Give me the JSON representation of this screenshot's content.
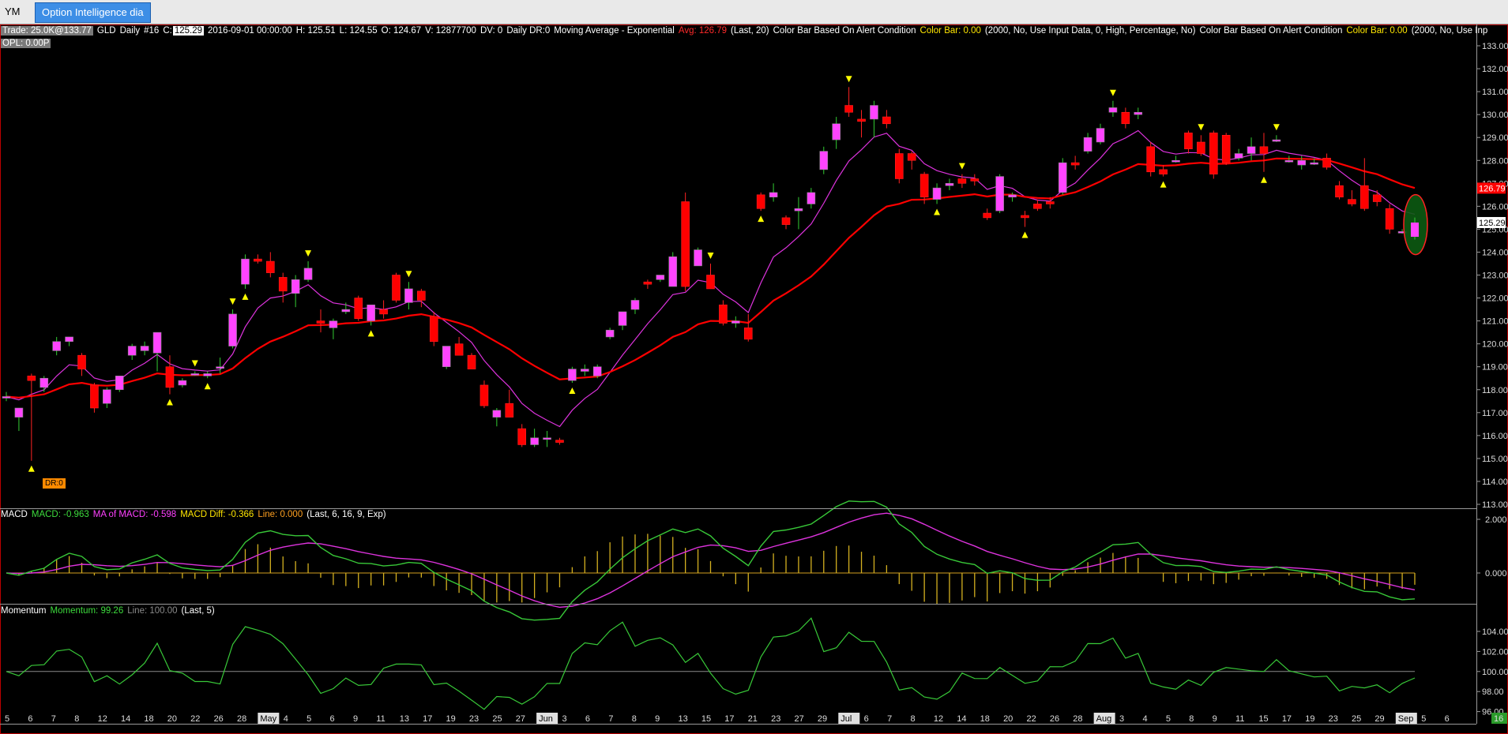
{
  "tabs": {
    "first": "YM",
    "active": "Option Intelligence dia"
  },
  "header": {
    "trade": "Trade: 25.0K@133.77",
    "symbol": "GLD",
    "interval": "Daily",
    "num": "#16",
    "c_label": "C:",
    "c_value": "125.29",
    "date": "2016-09-01 00:00:00",
    "h": "H: 125.51",
    "l": "L: 124.55",
    "o": "O: 124.67",
    "v": "V: 12877700",
    "dv": "DV: 0",
    "daily_dr": "Daily DR:0",
    "ma_name": "Moving Average - Exponential",
    "ma_avg": "Avg: 126.79",
    "ma_params": "(Last, 20)",
    "cb1_name": "Color Bar Based On Alert Condition",
    "cb1_value": "Color Bar: 0.00",
    "cb1_params": "(2000, No, Use Input Data, 0, High, Percentage, No)",
    "cb2_name": "Color Bar Based On Alert Condition",
    "cb2_value": "Color Bar: 0.00",
    "cb2_params": "(2000, No, Use Inp",
    "opl": "OPL: 0.00P"
  },
  "dr_badge": "DR:0",
  "macd": {
    "name": "MACD",
    "macd": "MACD: -0.963",
    "ma": "MA of MACD: -0.598",
    "diff": "MACD Diff: -0.366",
    "line": "Line: 0.000",
    "params": "(Last, 6, 16, 9, Exp)",
    "ticks": [
      "2.000",
      "0.000"
    ]
  },
  "momentum": {
    "name": "Momentum",
    "value": "Momentum: 99.26",
    "line": "Line: 100.00",
    "params": "(Last, 5)",
    "ticks": [
      "104.00",
      "102.00",
      "100.00",
      "98.00",
      "96.00"
    ]
  },
  "price_axis": {
    "ticks": [
      "133.00",
      "132.00",
      "131.00",
      "130.00",
      "129.00",
      "128.00",
      "127.00",
      "126.00",
      "125.00",
      "124.00",
      "123.00",
      "122.00",
      "121.00",
      "120.00",
      "119.00",
      "118.00",
      "117.00",
      "116.00",
      "115.00",
      "114.00",
      "113.00"
    ],
    "avg_marker": "126.79",
    "close_marker": "125.29"
  },
  "x_axis": {
    "labels": [
      "5",
      "6",
      "7",
      "8",
      "12",
      "14",
      "18",
      "20",
      "22",
      "26",
      "28",
      "May",
      "4",
      "5",
      "6",
      "9",
      "11",
      "13",
      "17",
      "19",
      "23",
      "25",
      "27",
      "Jun",
      "3",
      "6",
      "7",
      "8",
      "9",
      "13",
      "15",
      "17",
      "21",
      "23",
      "27",
      "29",
      "Jul",
      "6",
      "7",
      "8",
      "12",
      "14",
      "18",
      "20",
      "22",
      "26",
      "28",
      "Aug",
      "3",
      "4",
      "5",
      "8",
      "9",
      "11",
      "15",
      "17",
      "19",
      "23",
      "25",
      "29",
      "Sep",
      "5",
      "6"
    ],
    "corner": "16"
  },
  "colors": {
    "bull": "#ff44ff",
    "bear": "#ff0000",
    "ema": "#ff0000",
    "fast_ma": "#dd33dd",
    "macd": "#38c838",
    "signal": "#dd33dd",
    "hist": "#d4b020",
    "momentum": "#38c838",
    "alert": "#ffff00"
  },
  "chart_data": {
    "type": "candlestick",
    "title": "GLD Daily",
    "ylim": [
      113,
      133.5
    ],
    "candles": [
      [
        117.7,
        117.9,
        117.5,
        117.7
      ],
      [
        116.8,
        117.0,
        116.2,
        117.2
      ],
      [
        118.6,
        118.7,
        114.9,
        118.4
      ],
      [
        118.1,
        118.6,
        117.9,
        118.5
      ],
      [
        119.7,
        120.3,
        119.5,
        120.1
      ],
      [
        120.1,
        120.3,
        119.9,
        120.3
      ],
      [
        119.5,
        119.6,
        118.6,
        118.9
      ],
      [
        118.2,
        118.3,
        117.0,
        117.2
      ],
      [
        117.4,
        118.1,
        117.2,
        118.0
      ],
      [
        118.0,
        118.6,
        117.9,
        118.6
      ],
      [
        119.5,
        120.0,
        119.3,
        119.9
      ],
      [
        119.7,
        120.1,
        119.5,
        119.9
      ],
      [
        119.6,
        120.5,
        118.8,
        120.5
      ],
      [
        119.0,
        119.5,
        117.8,
        118.1
      ],
      [
        118.2,
        118.5,
        118.1,
        118.4
      ],
      [
        118.7,
        118.8,
        118.6,
        118.7
      ],
      [
        118.6,
        118.8,
        118.5,
        118.7
      ],
      [
        119.0,
        119.4,
        118.7,
        119.0
      ],
      [
        119.9,
        121.5,
        119.8,
        121.3
      ],
      [
        122.6,
        123.9,
        122.4,
        123.7
      ],
      [
        123.7,
        123.9,
        123.5,
        123.6
      ],
      [
        123.6,
        124.0,
        122.9,
        123.1
      ],
      [
        122.9,
        123.1,
        121.8,
        122.3
      ],
      [
        122.2,
        123.0,
        121.6,
        122.8
      ],
      [
        122.8,
        123.6,
        122.7,
        123.3
      ],
      [
        121.0,
        121.5,
        120.5,
        120.9
      ],
      [
        120.7,
        121.1,
        120.2,
        121.0
      ],
      [
        121.4,
        121.8,
        121.3,
        121.5
      ],
      [
        122.0,
        122.1,
        121.0,
        121.1
      ],
      [
        121.0,
        121.5,
        120.8,
        121.7
      ],
      [
        121.5,
        121.9,
        121.1,
        121.3
      ],
      [
        123.0,
        123.1,
        121.8,
        121.9
      ],
      [
        121.8,
        122.7,
        121.5,
        122.4
      ],
      [
        122.3,
        122.4,
        121.6,
        121.9
      ],
      [
        121.2,
        121.4,
        119.9,
        120.1
      ],
      [
        119.0,
        119.2,
        118.9,
        119.9
      ],
      [
        120.0,
        120.3,
        119.5,
        119.5
      ],
      [
        119.5,
        119.6,
        118.9,
        118.9
      ],
      [
        118.2,
        118.4,
        117.2,
        117.3
      ],
      [
        116.8,
        117.2,
        116.4,
        117.1
      ],
      [
        117.4,
        118.0,
        116.8,
        116.8
      ],
      [
        116.3,
        116.5,
        115.5,
        115.6
      ],
      [
        115.6,
        116.3,
        115.5,
        115.9
      ],
      [
        115.9,
        116.2,
        115.5,
        115.9
      ],
      [
        115.8,
        115.9,
        115.6,
        115.7
      ],
      [
        118.4,
        119.0,
        118.3,
        118.9
      ],
      [
        118.8,
        119.1,
        118.6,
        118.9
      ],
      [
        118.6,
        119.1,
        118.5,
        119.0
      ],
      [
        120.3,
        120.7,
        120.2,
        120.6
      ],
      [
        120.8,
        121.4,
        120.6,
        121.4
      ],
      [
        121.5,
        122.0,
        121.3,
        121.9
      ],
      [
        122.7,
        122.8,
        122.4,
        122.6
      ],
      [
        122.8,
        123.0,
        122.7,
        123.0
      ],
      [
        122.5,
        124.0,
        122.5,
        123.8
      ],
      [
        126.2,
        126.6,
        122.3,
        122.5
      ],
      [
        123.4,
        124.2,
        123.4,
        124.1
      ],
      [
        123.0,
        123.5,
        122.6,
        122.4
      ],
      [
        121.7,
        121.9,
        120.8,
        120.9
      ],
      [
        120.9,
        121.2,
        120.7,
        121.0
      ],
      [
        120.7,
        121.3,
        120.1,
        120.2
      ],
      [
        126.5,
        126.6,
        125.8,
        125.9
      ],
      [
        126.4,
        127.0,
        126.2,
        126.6
      ],
      [
        125.5,
        125.6,
        125.0,
        125.2
      ],
      [
        125.8,
        126.4,
        125.0,
        125.9
      ],
      [
        126.1,
        126.8,
        125.9,
        126.6
      ],
      [
        127.6,
        128.6,
        127.4,
        128.4
      ],
      [
        128.9,
        129.9,
        128.5,
        129.6
      ],
      [
        130.4,
        131.2,
        129.9,
        130.1
      ],
      [
        129.8,
        130.2,
        129.0,
        129.7
      ],
      [
        129.8,
        130.6,
        129.0,
        130.4
      ],
      [
        129.9,
        130.2,
        129.4,
        129.6
      ],
      [
        128.3,
        128.5,
        127.0,
        127.2
      ],
      [
        128.3,
        128.4,
        127.6,
        128.0
      ],
      [
        127.4,
        127.5,
        126.1,
        126.4
      ],
      [
        126.3,
        127.0,
        126.1,
        126.8
      ],
      [
        126.9,
        127.2,
        126.7,
        127.0
      ],
      [
        127.2,
        127.4,
        126.8,
        127.0
      ],
      [
        127.2,
        127.4,
        126.9,
        127.1
      ],
      [
        125.7,
        125.9,
        125.4,
        125.5
      ],
      [
        125.8,
        127.4,
        125.7,
        127.3
      ],
      [
        126.4,
        126.6,
        126.2,
        126.5
      ],
      [
        125.6,
        125.8,
        125.1,
        125.5
      ],
      [
        126.1,
        126.3,
        125.8,
        125.9
      ],
      [
        126.2,
        126.4,
        125.9,
        126.1
      ],
      [
        126.6,
        128.1,
        126.5,
        127.9
      ],
      [
        127.9,
        128.2,
        127.6,
        127.8
      ],
      [
        128.4,
        129.2,
        128.3,
        129.0
      ],
      [
        128.8,
        129.6,
        128.7,
        129.4
      ],
      [
        130.1,
        130.6,
        129.9,
        130.3
      ],
      [
        130.1,
        130.3,
        129.4,
        129.6
      ],
      [
        130.0,
        130.3,
        129.8,
        130.1
      ],
      [
        128.6,
        128.8,
        127.3,
        127.5
      ],
      [
        127.6,
        127.8,
        127.3,
        127.4
      ],
      [
        128.0,
        128.2,
        127.9,
        128.0
      ],
      [
        129.2,
        129.3,
        128.3,
        128.5
      ],
      [
        128.8,
        129.1,
        128.2,
        128.3
      ],
      [
        129.2,
        129.3,
        127.2,
        127.4
      ],
      [
        129.1,
        129.2,
        127.8,
        127.9
      ],
      [
        128.1,
        128.5,
        128.0,
        128.3
      ],
      [
        128.3,
        129.0,
        128.0,
        128.6
      ],
      [
        128.6,
        129.2,
        127.5,
        128.3
      ],
      [
        128.9,
        129.1,
        128.8,
        128.9
      ],
      [
        128.0,
        128.2,
        127.9,
        128.0
      ],
      [
        127.8,
        128.2,
        127.6,
        128.0
      ],
      [
        127.9,
        128.1,
        127.8,
        127.9
      ],
      [
        128.1,
        128.3,
        127.6,
        127.7
      ],
      [
        126.9,
        127.1,
        126.3,
        126.4
      ],
      [
        126.3,
        126.7,
        126.0,
        126.1
      ],
      [
        126.9,
        128.1,
        125.8,
        125.9
      ],
      [
        126.5,
        126.7,
        126.0,
        126.2
      ],
      [
        125.9,
        126.1,
        124.8,
        125.0
      ],
      [
        124.9,
        125.0,
        124.8,
        124.9
      ],
      [
        124.67,
        125.51,
        124.55,
        125.29
      ]
    ]
  }
}
